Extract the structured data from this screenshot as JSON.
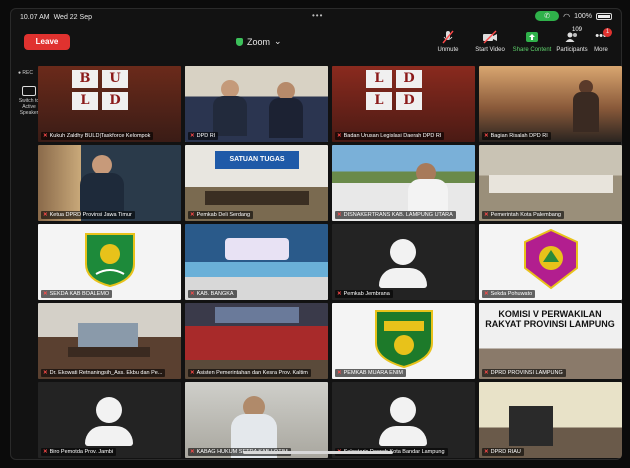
{
  "status": {
    "time": "10.07 AM",
    "date": "Wed 22 Sep",
    "battery": "100%"
  },
  "toolbar": {
    "leave_label": "Leave",
    "title": "Zoom",
    "unmute_label": "Unmute",
    "start_video_label": "Start Video",
    "share_content_label": "Share Content",
    "participants_label": "Participants",
    "participants_count": "109",
    "more_label": "More",
    "more_badge": "1"
  },
  "left_rail": {
    "rec_label": "REC",
    "switch_label": "Switch to Active Speaker"
  },
  "colors": {
    "leave": "#e0322f",
    "active_speaker": "#b5e07a",
    "share": "#5fd36d",
    "mic_off": "#ff4a4a"
  },
  "tiles": [
    {
      "name": "Kukuh Zaldhy BULD|Taskforce Kelompok",
      "type": "letters",
      "letters": [
        "B",
        "U",
        "L",
        "D"
      ]
    },
    {
      "name": "DPD RI",
      "type": "video"
    },
    {
      "name": "Badan Urusan Legislasi Daerah DPD RI",
      "type": "letters",
      "letters": [
        "L",
        "D",
        "L",
        "D"
      ]
    },
    {
      "name": "Bagian Risalah DPD RI",
      "type": "video"
    },
    {
      "name": "Ketua DPRD Provinsi Jawa Timur",
      "type": "video"
    },
    {
      "name": "Pemkab Deli Serdang",
      "type": "banner",
      "banner": "SATUAN TUGAS"
    },
    {
      "name": "DISNAKERTRANS KAB. LAMPUNG UTARA",
      "type": "video"
    },
    {
      "name": "Pemerintah Kota Palembang",
      "type": "video"
    },
    {
      "name": "SEKDA KAB BOALEMO",
      "type": "logo"
    },
    {
      "name": "KAB. BANGKA",
      "type": "video"
    },
    {
      "name": "Pemkab Jembrana",
      "type": "avatar"
    },
    {
      "name": "Sekda Pohuwato",
      "type": "logo"
    },
    {
      "name": "Dr. Ekowati Retnaningsih_Ass. Ekbu dan Pe...",
      "type": "video"
    },
    {
      "name": "Asisten Pemerintahan dan Kesra Prov. Kaltim",
      "type": "video"
    },
    {
      "name": "PEMKAB MUARA ENIM",
      "type": "logo"
    },
    {
      "name": "DPRD PROVINSI LAMPUNG",
      "type": "banner",
      "banner": "KOMISI V PERWAKILAN RAKYAT PROVINSI LAMPUNG"
    },
    {
      "name": "Biro Pemotda Prov. Jambi",
      "type": "avatar"
    },
    {
      "name": "KABAG HUKUM SETDA KAB.LOTIM",
      "type": "video"
    },
    {
      "name": "Sekretaris Daerah Kota Bandar Lampung",
      "type": "avatar"
    },
    {
      "name": "DPRD RIAU",
      "type": "video"
    }
  ]
}
